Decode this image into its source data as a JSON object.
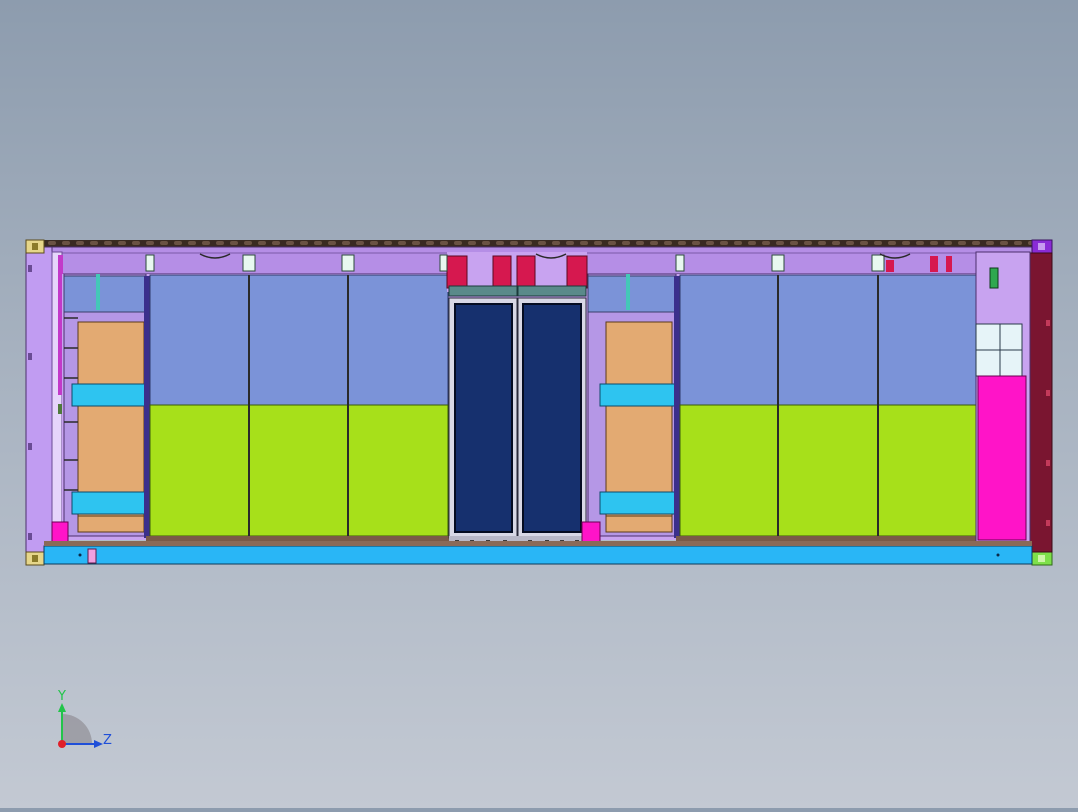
{
  "viewport": {
    "background_top": "#8d9cae",
    "background_bottom": "#c3c9d3"
  },
  "model": {
    "frame_color": "#d9b94a",
    "roof_color": "#3a2a22",
    "upper_beam_color": "#b58ee6",
    "floor_beam_color": "#29b6f6",
    "end_panel_left_color": "#c19cf2",
    "end_panel_right_color": "#7a1530",
    "cabinet_top_color": "#7b93d8",
    "cabinet_bottom_color": "#a7e01a",
    "door_color": "#16306e",
    "shelf_color": "#e3aa72",
    "bracket_color": "#2ec4f0",
    "magenta_unit_color": "#ff14c8",
    "crimson_color": "#d6184f"
  },
  "triad": {
    "y_label": "Y",
    "z_label": "Z",
    "y_color": "#22c44a",
    "z_color": "#1f4fd8",
    "origin_color": "#e0202a"
  }
}
